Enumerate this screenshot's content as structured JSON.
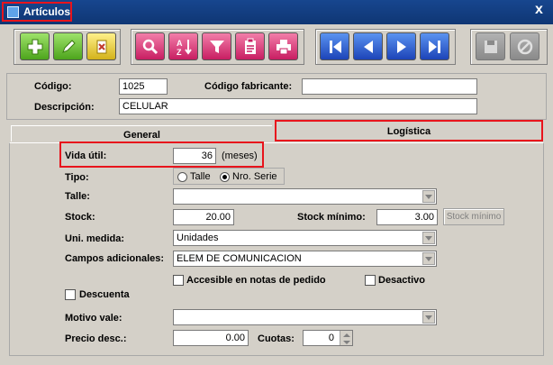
{
  "window": {
    "title": "Artículos",
    "close_label": "x"
  },
  "toolbar": {
    "groups": [
      {
        "buttons": [
          "plus-icon",
          "pencil-icon",
          "delete-document-icon"
        ]
      },
      {
        "buttons": [
          "zoom-icon",
          "sort-az-icon",
          "filter-icon",
          "clipboard-icon",
          "printer-icon"
        ]
      },
      {
        "buttons": [
          "first-record-icon",
          "previous-record-icon",
          "next-record-icon",
          "last-record-icon"
        ]
      },
      {
        "buttons": [
          "save-icon",
          "cancel-icon"
        ]
      }
    ]
  },
  "header": {
    "codigo_label": "Código:",
    "codigo_value": "1025",
    "codigo_fabricante_label": "Código fabricante:",
    "codigo_fabricante_value": "",
    "descripcion_label": "Descripción:",
    "descripcion_value": "CELULAR"
  },
  "tabs": [
    {
      "label": "General",
      "active": false
    },
    {
      "label": "Logística",
      "active": true
    }
  ],
  "form": {
    "vida_util_label": "Vida útil:",
    "vida_util_value": "36",
    "vida_util_unit": "(meses)",
    "tipo_label": "Tipo:",
    "tipo_options": [
      {
        "label": "Talle",
        "checked": false
      },
      {
        "label": "Nro. Serie",
        "checked": true
      }
    ],
    "talle_label": "Talle:",
    "talle_value": "",
    "stock_label": "Stock:",
    "stock_value": "20.00",
    "stock_minimo_label": "Stock mínimo:",
    "stock_minimo_value": "3.00",
    "stock_minimo_button": "Stock mínimo",
    "uni_medida_label": "Uni. medida:",
    "uni_medida_value": "Unidades",
    "campos_label": "Campos adicionales:",
    "campos_value": "ELEM DE COMUNICACION",
    "accesible_label": "Accesible en notas de pedido",
    "accesible_checked": false,
    "desactivo_label": "Desactivo",
    "desactivo_checked": false,
    "descuenta_label": "Descuenta",
    "descuenta_checked": false,
    "motivo_vale_label": "Motivo vale:",
    "motivo_vale_value": "",
    "precio_desc_label": "Precio desc.:",
    "precio_desc_value": "0.00",
    "cuotas_label": "Cuotas:",
    "cuotas_value": "0"
  }
}
